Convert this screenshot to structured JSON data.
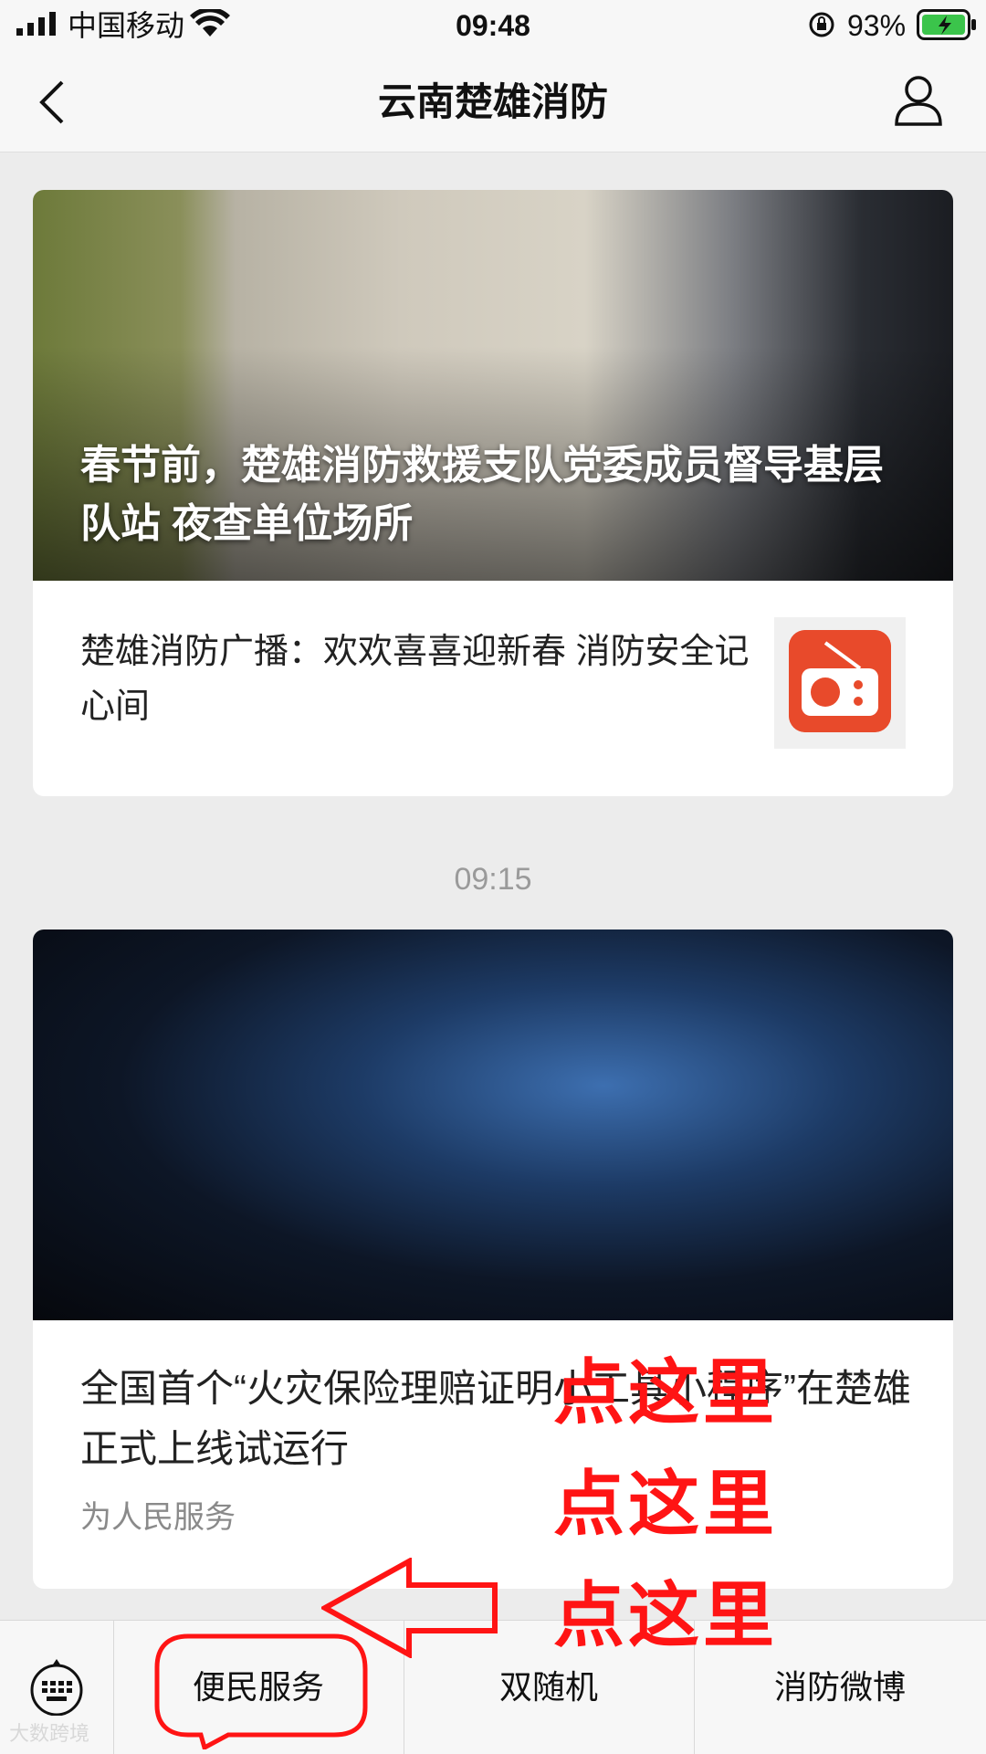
{
  "status_bar": {
    "carrier": "中国移动",
    "time": "09:48",
    "battery_percent": "93%"
  },
  "nav": {
    "title": "云南楚雄消防"
  },
  "articles": [
    {
      "hero_title": "春节前，楚雄消防救援支队党委成员督导基层队站 夜查单位场所",
      "sub_title": "楚雄消防广播：欢欢喜喜迎新春 消防安全记心间"
    },
    {
      "title": "全国首个“火灾保险理赔证明小工具小程序”在楚雄正式上线试运行",
      "source": "为人民服务"
    }
  ],
  "time_separator": "09:15",
  "menu": {
    "items": [
      "便民服务",
      "双随机",
      "消防微博"
    ]
  },
  "annotations": [
    "点这里",
    "点这里",
    "点这里"
  ],
  "watermark": "大数跨境",
  "colors": {
    "accent_red": "#ff1414",
    "radio_icon": "#e84a2b"
  }
}
